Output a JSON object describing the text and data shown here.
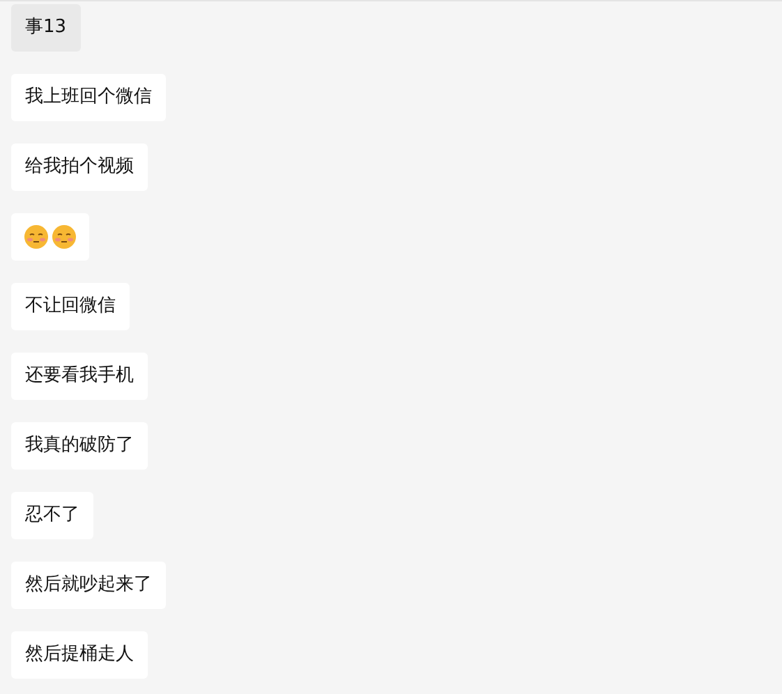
{
  "messages": [
    {
      "kind": "text",
      "text": "事13",
      "selected": true
    },
    {
      "kind": "text",
      "text": "我上班回个微信",
      "selected": false
    },
    {
      "kind": "text",
      "text": "给我拍个视频",
      "selected": false
    },
    {
      "kind": "emoji",
      "emojis": [
        {
          "kind": "blush"
        },
        {
          "kind": "blush"
        }
      ],
      "selected": false
    },
    {
      "kind": "text",
      "text": "不让回微信",
      "selected": false
    },
    {
      "kind": "text",
      "text": "还要看我手机",
      "selected": false
    },
    {
      "kind": "text",
      "text": "我真的破防了",
      "selected": false
    },
    {
      "kind": "text",
      "text": "忍不了",
      "selected": false
    },
    {
      "kind": "text",
      "text": "然后就吵起来了",
      "selected": false
    },
    {
      "kind": "text",
      "text": "然后提桶走人",
      "selected": false
    }
  ]
}
